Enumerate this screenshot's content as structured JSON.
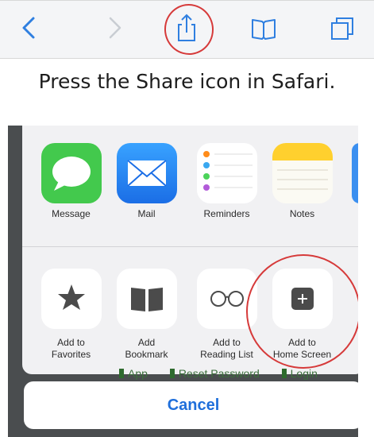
{
  "toolbar": {
    "buttons": [
      {
        "name": "back-chevron-icon"
      },
      {
        "name": "forward-chevron-icon"
      },
      {
        "name": "share-icon"
      },
      {
        "name": "bookmarks-icon"
      },
      {
        "name": "tabs-icon"
      }
    ],
    "accent_color": "#2f7fe0",
    "annotation_color": "#d63a3a"
  },
  "caption": "Press the Share icon in Safari.",
  "share_sheet": {
    "apps": [
      {
        "label": "Message",
        "icon": "message-icon",
        "color": "#43c94d"
      },
      {
        "label": "Mail",
        "icon": "mail-icon",
        "color": "#2e8ef2"
      },
      {
        "label": "Reminders",
        "icon": "reminders-icon",
        "color": "#ffffff"
      },
      {
        "label": "Notes",
        "icon": "notes-icon",
        "color": "#ffd02e"
      }
    ],
    "actions": [
      {
        "label": "Add to\nFavorites",
        "icon": "star-icon"
      },
      {
        "label": "Add\nBookmark",
        "icon": "book-icon"
      },
      {
        "label": "Add to\nReading List",
        "icon": "glasses-icon"
      },
      {
        "label": "Add to\nHome Screen",
        "icon": "plus-square-icon"
      }
    ],
    "background_links": [
      "App",
      "Reset Password",
      "Login"
    ],
    "cancel_label": "Cancel"
  }
}
